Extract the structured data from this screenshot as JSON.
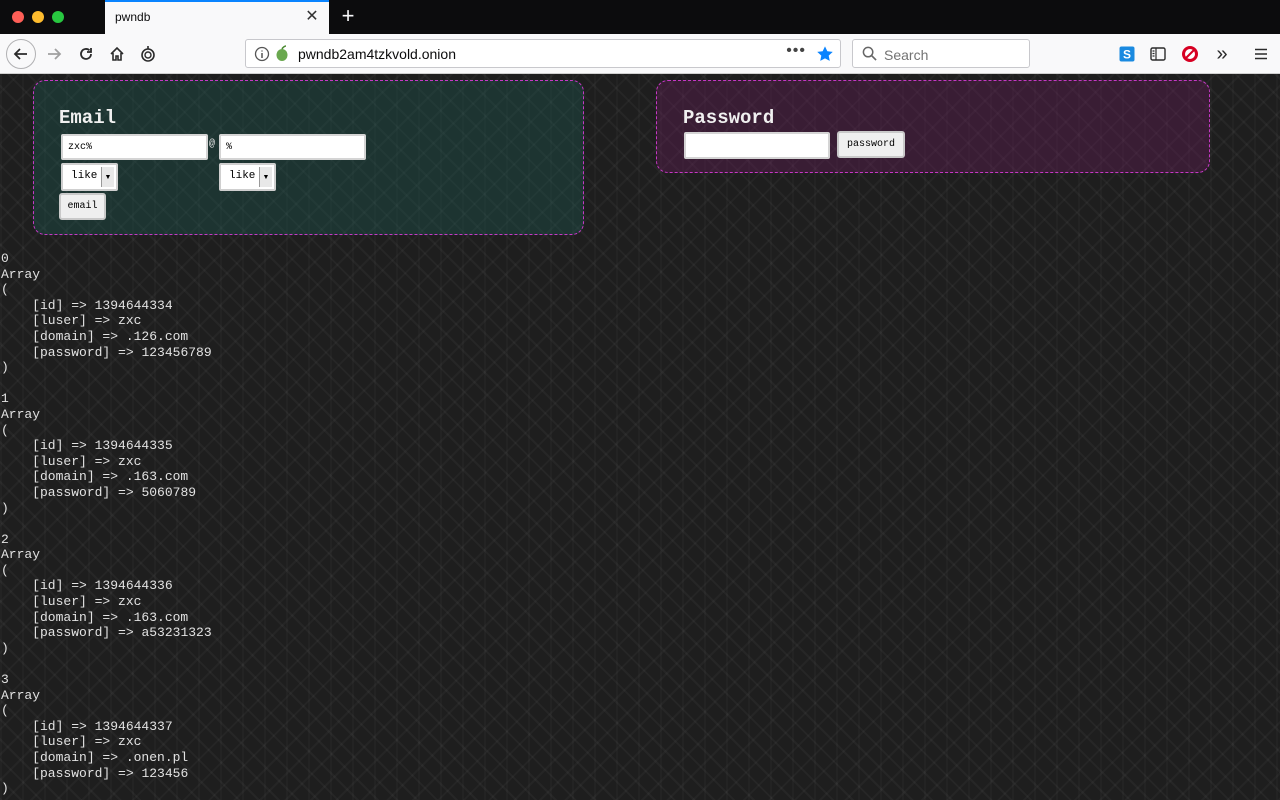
{
  "browser": {
    "tab_title": "pwndb",
    "tab_close": "✕",
    "new_tab": "+",
    "url": "pwndb2am4tzkvold.onion",
    "page_actions": "•••",
    "search_placeholder": "Search",
    "overflow": "»"
  },
  "email_form": {
    "title": "Email",
    "luser_value": "zxc%",
    "at": "@",
    "domain_value": "%",
    "luser_operator": "like",
    "domain_operator": "like",
    "submit_label": "email"
  },
  "password_form": {
    "title": "Password",
    "password_value": "",
    "submit_label": "password"
  },
  "results": [
    {
      "index": "0",
      "id": "1394644334",
      "luser": "zxc",
      "domain": ".126.com",
      "password": "123456789"
    },
    {
      "index": "1",
      "id": "1394644335",
      "luser": "zxc",
      "domain": ".163.com",
      "password": "5060789"
    },
    {
      "index": "2",
      "id": "1394644336",
      "luser": "zxc",
      "domain": ".163.com",
      "password": "a53231323"
    },
    {
      "index": "3",
      "id": "1394644337",
      "luser": "zxc",
      "domain": ".onen.pl",
      "password": "123456"
    }
  ],
  "colors": {
    "tab_accent": "#0a84ff",
    "email_panel": "#1e5f55",
    "password_panel": "#6e1e5f",
    "panel_border": "#c637c6",
    "bookmark_star": "#0a84ff"
  }
}
